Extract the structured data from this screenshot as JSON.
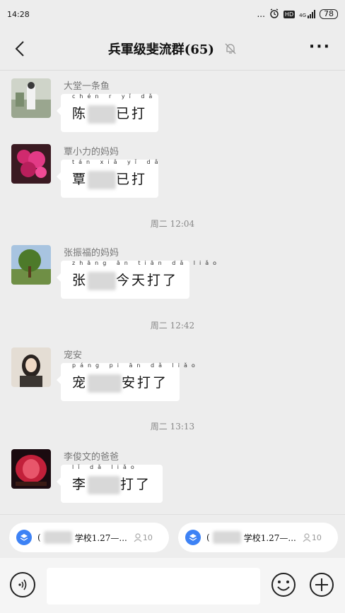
{
  "status": {
    "time": "14:28",
    "dots": "...",
    "hd": "HD",
    "battery": "78",
    "network": "4G"
  },
  "header": {
    "title": "兵軍级斐流群(65)"
  },
  "messages": [
    {
      "sender": "大堂一条鱼",
      "pinyin": "chén  r  yǐ  dǎ",
      "prefix": "陈",
      "suffix": "已打"
    },
    {
      "sender": "覃小力的妈妈",
      "pinyin": "tán xiǎ    yǐ  dǎ",
      "prefix": "覃",
      "suffix": "已打"
    },
    {
      "sender": "张振福的妈妈",
      "pinyin": "zhāng    ān tiān dǎ  liǎo",
      "prefix": "张",
      "suffix": "今天打了"
    },
    {
      "sender": "宠安",
      "pinyin": "páng pi     ān  dǎ  liǎo",
      "prefix": "宠",
      "suffix": "安打了"
    },
    {
      "sender": "李俊文的爸爸",
      "pinyin": "lǐ         dǎ  liǎo",
      "prefix": "李",
      "suffix": "打了"
    }
  ],
  "times": [
    "周二 12:04",
    "周二 12:42",
    "周二 13:13"
  ],
  "mini_programs": [
    {
      "text": "学校1.27—...",
      "count": "10"
    },
    {
      "text": "学校1.27—...",
      "count": "10"
    }
  ],
  "colors": {
    "accent": "#3d82f5",
    "background": "#ededed"
  }
}
